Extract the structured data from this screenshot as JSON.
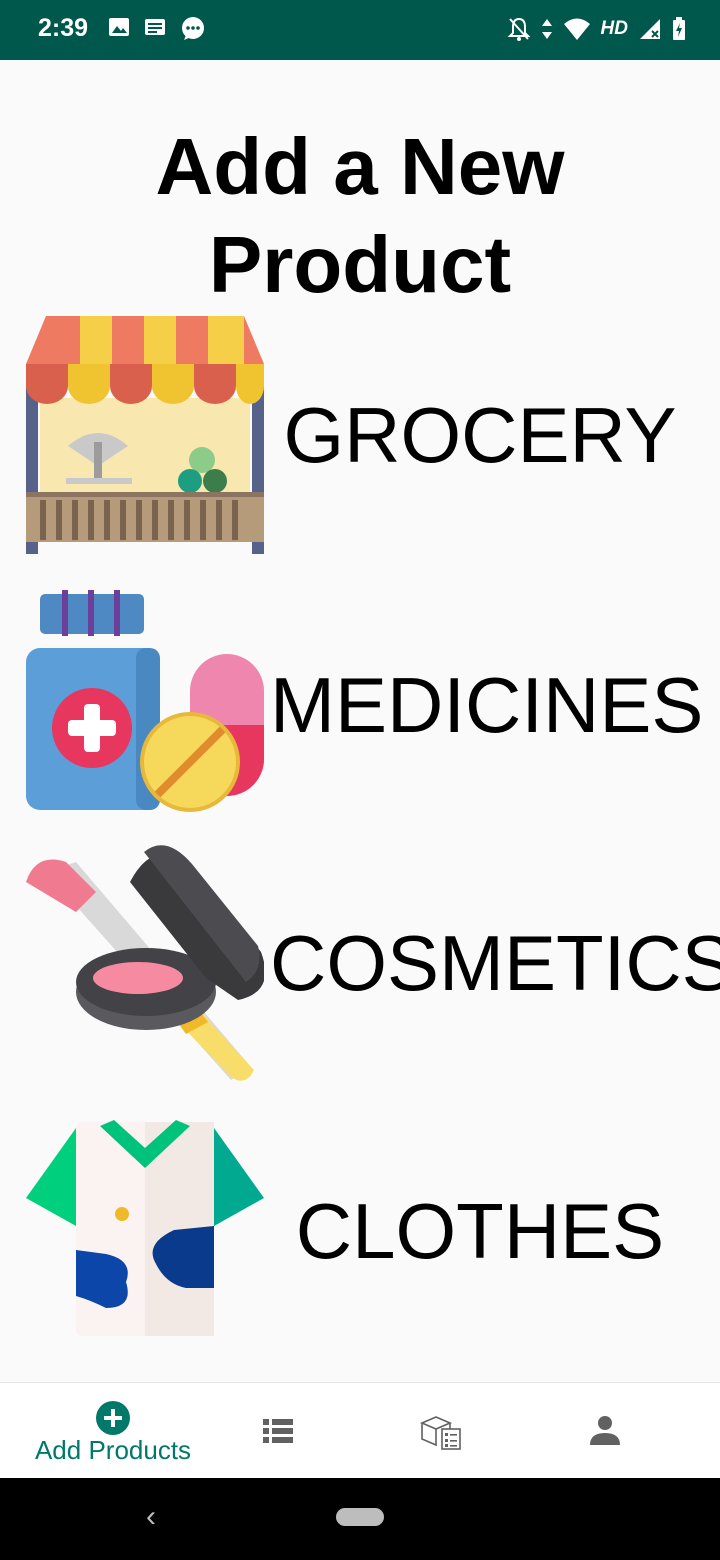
{
  "status_bar": {
    "time": "2:39",
    "network_label": "HD",
    "left_icons": [
      "image-icon",
      "news-icon",
      "chat-bubble-icon"
    ],
    "right_icons": [
      "notifications-off-icon",
      "data-arrows-icon",
      "wifi-icon",
      "signal-icon",
      "battery-charging-icon"
    ]
  },
  "page": {
    "title_line1": "Add a New",
    "title_line2": "Product"
  },
  "categories": [
    {
      "label": "GROCERY",
      "icon": "market-stall-icon"
    },
    {
      "label": "MEDICINES",
      "icon": "medicine-icon"
    },
    {
      "label": "COSMETICS",
      "icon": "cosmetics-icon"
    },
    {
      "label": "CLOTHES",
      "icon": "shirt-icon"
    }
  ],
  "bottom_nav": {
    "items": [
      {
        "label": "Add Products",
        "icon": "add-circle-icon",
        "active": true
      },
      {
        "label": "",
        "icon": "list-icon",
        "active": false
      },
      {
        "label": "",
        "icon": "inventory-box-icon",
        "active": false
      },
      {
        "label": "",
        "icon": "person-icon",
        "active": false
      }
    ],
    "accent_color": "#00796b",
    "inactive_color": "#616161"
  },
  "colors": {
    "status_bar": "#00574b",
    "background": "#fafafa"
  }
}
